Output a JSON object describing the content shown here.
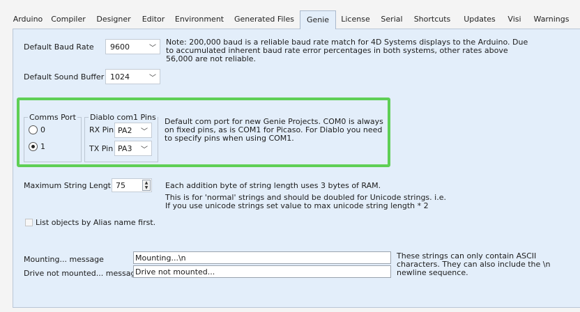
{
  "tabs": [
    {
      "label": "Arduino"
    },
    {
      "label": "Compiler"
    },
    {
      "label": "Designer"
    },
    {
      "label": "Editor"
    },
    {
      "label": "Environment"
    },
    {
      "label": "Generated Files"
    },
    {
      "label": "Genie",
      "active": true
    },
    {
      "label": "License"
    },
    {
      "label": "Serial"
    },
    {
      "label": "Shortcuts"
    },
    {
      "label": "Updates"
    },
    {
      "label": "Visi"
    },
    {
      "label": "Warnings"
    }
  ],
  "baud": {
    "label": "Default Baud Rate",
    "value": "9600",
    "note": [
      "Note: 200,000 baud is a reliable baud rate match for 4D Systems displays to the Arduino. Due",
      "to accumulated inherent baud rate error percentages in both systems, other rates above",
      "56,000 are not reliable."
    ]
  },
  "sound": {
    "label": "Default Sound Buffer",
    "value": "1024"
  },
  "comms": {
    "title": "Comms Port",
    "options": [
      "0",
      "1"
    ],
    "selected": "1"
  },
  "diablo": {
    "title": "Diablo com1 Pins",
    "rx_label": "RX Pin",
    "rx_value": "PA2",
    "tx_label": "TX Pin",
    "tx_value": "PA3"
  },
  "com_note": [
    "Default com port for new Genie Projects. COM0 is always",
    "on fixed pins, as is COM1 for Picaso. For Diablo you need",
    "to specify pins when using COM1."
  ],
  "strlen": {
    "label": "Maximum String Length",
    "value": "75",
    "note1": "Each addition byte of string length uses 3 bytes of RAM.",
    "note2": [
      "This is for 'normal' strings and should be doubled for Unicode strings. i.e.",
      "If you use unicode strings set value to max unicode string length * 2"
    ]
  },
  "alias_checkbox": {
    "label": "List objects by Alias name first.",
    "checked": false
  },
  "mounting": {
    "label": "Mounting... message",
    "value": "Mounting...\\n"
  },
  "not_mounted": {
    "label": "Drive not mounted... message",
    "value": "Drive not mounted..."
  },
  "strings_note": [
    "These strings can only contain ASCII",
    "characters. They can also include the \\n",
    "newline sequence."
  ]
}
